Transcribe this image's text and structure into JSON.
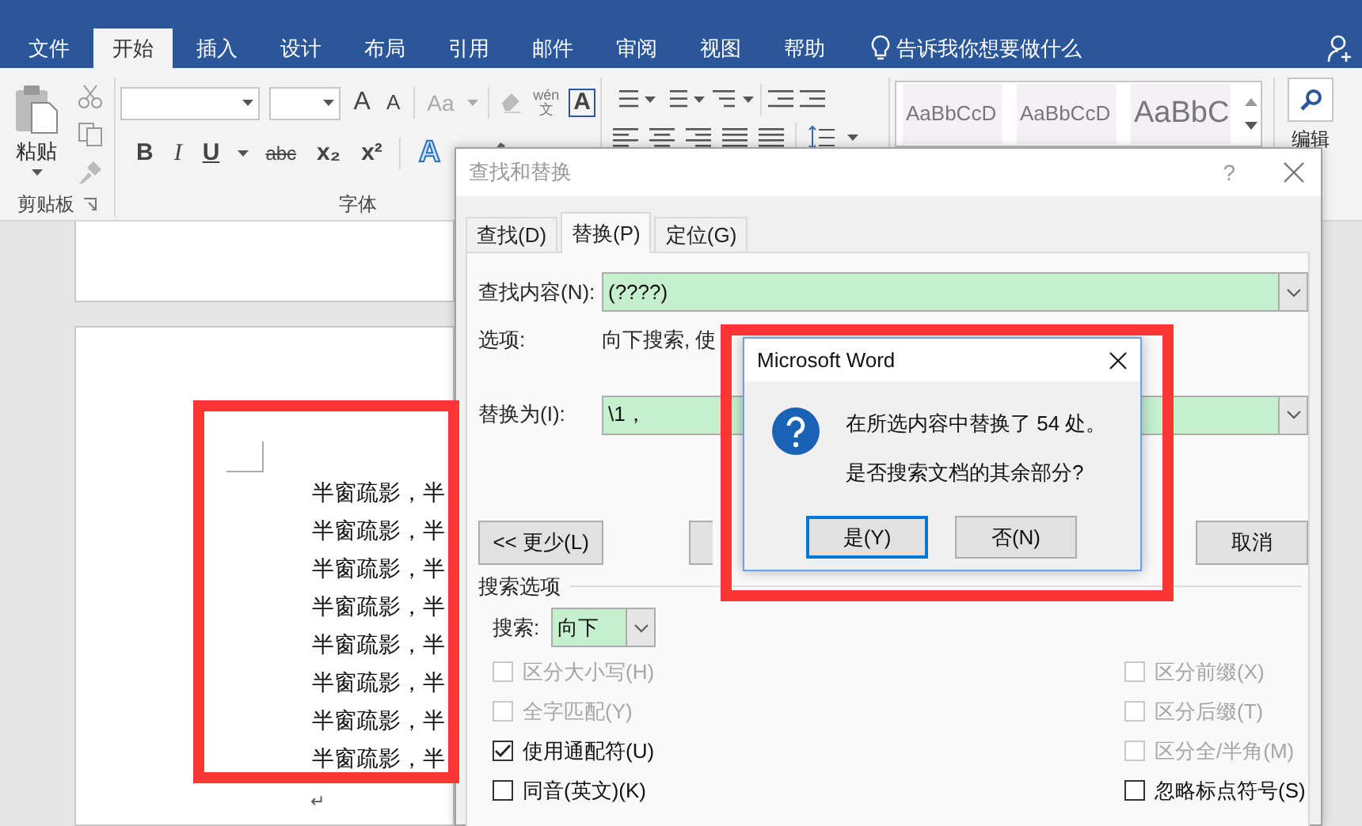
{
  "ribbon_tabs": [
    {
      "label": "文件",
      "selected": false
    },
    {
      "label": "开始",
      "selected": true
    },
    {
      "label": "插入",
      "selected": false
    },
    {
      "label": "设计",
      "selected": false
    },
    {
      "label": "布局",
      "selected": false
    },
    {
      "label": "引用",
      "selected": false
    },
    {
      "label": "邮件",
      "selected": false
    },
    {
      "label": "审阅",
      "selected": false
    },
    {
      "label": "视图",
      "selected": false
    },
    {
      "label": "帮助",
      "selected": false
    }
  ],
  "tell_me": "告诉我你想要做什么",
  "clipboard": {
    "paste": "粘贴",
    "label": "剪贴板"
  },
  "font": {
    "label": "字体",
    "grow": "A",
    "shrink": "A",
    "change_case": "Aa",
    "phonetic_top": "wén",
    "phonetic_bottom": "文",
    "char_border": "A",
    "format": [
      "B",
      "I",
      "U",
      "abc",
      "x₂",
      "x²"
    ],
    "effects": "A"
  },
  "styles": [
    "AaBbCcD",
    "AaBbCcD",
    "AaBbC"
  ],
  "editing": "编辑",
  "document": {
    "lines": [
      "半窗疏影，半",
      "半窗疏影，半",
      "半窗疏影，半",
      "半窗疏影，半",
      "半窗疏影，半",
      "半窗疏影，半",
      "半窗疏影，半",
      "半窗疏影，半"
    ],
    "paragraph_mark": "↵"
  },
  "find_replace": {
    "title": "查找和替换",
    "help": "?",
    "tabs": [
      {
        "label": "查找(D)",
        "selected": false
      },
      {
        "label": "替换(P)",
        "selected": true
      },
      {
        "label": "定位(G)",
        "selected": false
      }
    ],
    "find_label": "查找内容(N):",
    "find_value": "(????)",
    "options_label": "选项:",
    "options_value": "向下搜索, 使",
    "replace_label": "替换为(I):",
    "replace_value": "\\1，",
    "less_button": "<< 更少(L)",
    "cancel_button": "取消",
    "search_options_title": "搜索选项",
    "search_label": "搜索:",
    "search_value": "向下",
    "left_options": [
      {
        "label": "区分大小写(H)",
        "checked": false,
        "disabled": true
      },
      {
        "label": "全字匹配(Y)",
        "checked": false,
        "disabled": true
      },
      {
        "label": "使用通配符(U)",
        "checked": true,
        "disabled": false
      },
      {
        "label": "同音(英文)(K)",
        "checked": false,
        "disabled": false
      }
    ],
    "right_options": [
      {
        "label": "区分前缀(X)",
        "checked": false,
        "disabled": true
      },
      {
        "label": "区分后缀(T)",
        "checked": false,
        "disabled": true
      },
      {
        "label": "区分全/半角(M)",
        "checked": false,
        "disabled": true
      },
      {
        "label": "忽略标点符号(S)",
        "checked": false,
        "disabled": false
      }
    ]
  },
  "message_box": {
    "title": "Microsoft Word",
    "lines": [
      "在所选内容中替换了 54 处。",
      "是否搜索文档的其余部分?"
    ],
    "buttons": [
      {
        "label": "是(Y)",
        "default": true
      },
      {
        "label": "否(N)",
        "default": false
      }
    ]
  }
}
